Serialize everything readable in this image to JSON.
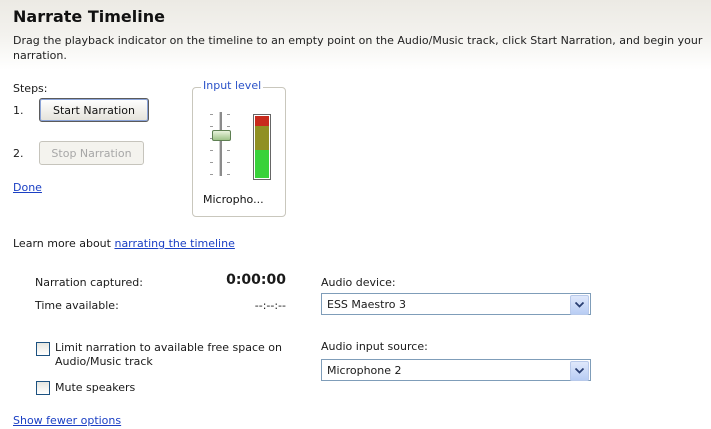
{
  "header": {
    "title": "Narrate Timeline",
    "description": "Drag the playback indicator on the timeline to an empty point on the Audio/Music track, click Start Narration, and begin your narration."
  },
  "steps": {
    "label": "Steps:",
    "step1_num": "1.",
    "step2_num": "2.",
    "start_button": "Start Narration",
    "stop_button": "Stop Narration",
    "done_link": "Done"
  },
  "input_level": {
    "legend": "Input level",
    "device_label": "Micropho...",
    "volume_level": 0.65,
    "meter_colors": {
      "red": "#c82a1c",
      "olive": "#909022",
      "green": "#38d23a"
    }
  },
  "learn_more": {
    "prefix": "Learn more about ",
    "link": "narrating the timeline"
  },
  "narration": {
    "captured_label": "Narration captured:",
    "captured_value": "0:00:00",
    "available_label": "Time available:",
    "available_value": "--:--:--"
  },
  "options": {
    "limit_label": "Limit narration to available free space on Audio/Music track",
    "mute_label": "Mute speakers",
    "limit_checked": false,
    "mute_checked": false
  },
  "audio": {
    "device_label": "Audio device:",
    "device_value": "ESS Maestro 3",
    "source_label": "Audio input source:",
    "source_value": "Microphone 2"
  },
  "footer": {
    "fewer_options_link": "Show fewer options"
  }
}
